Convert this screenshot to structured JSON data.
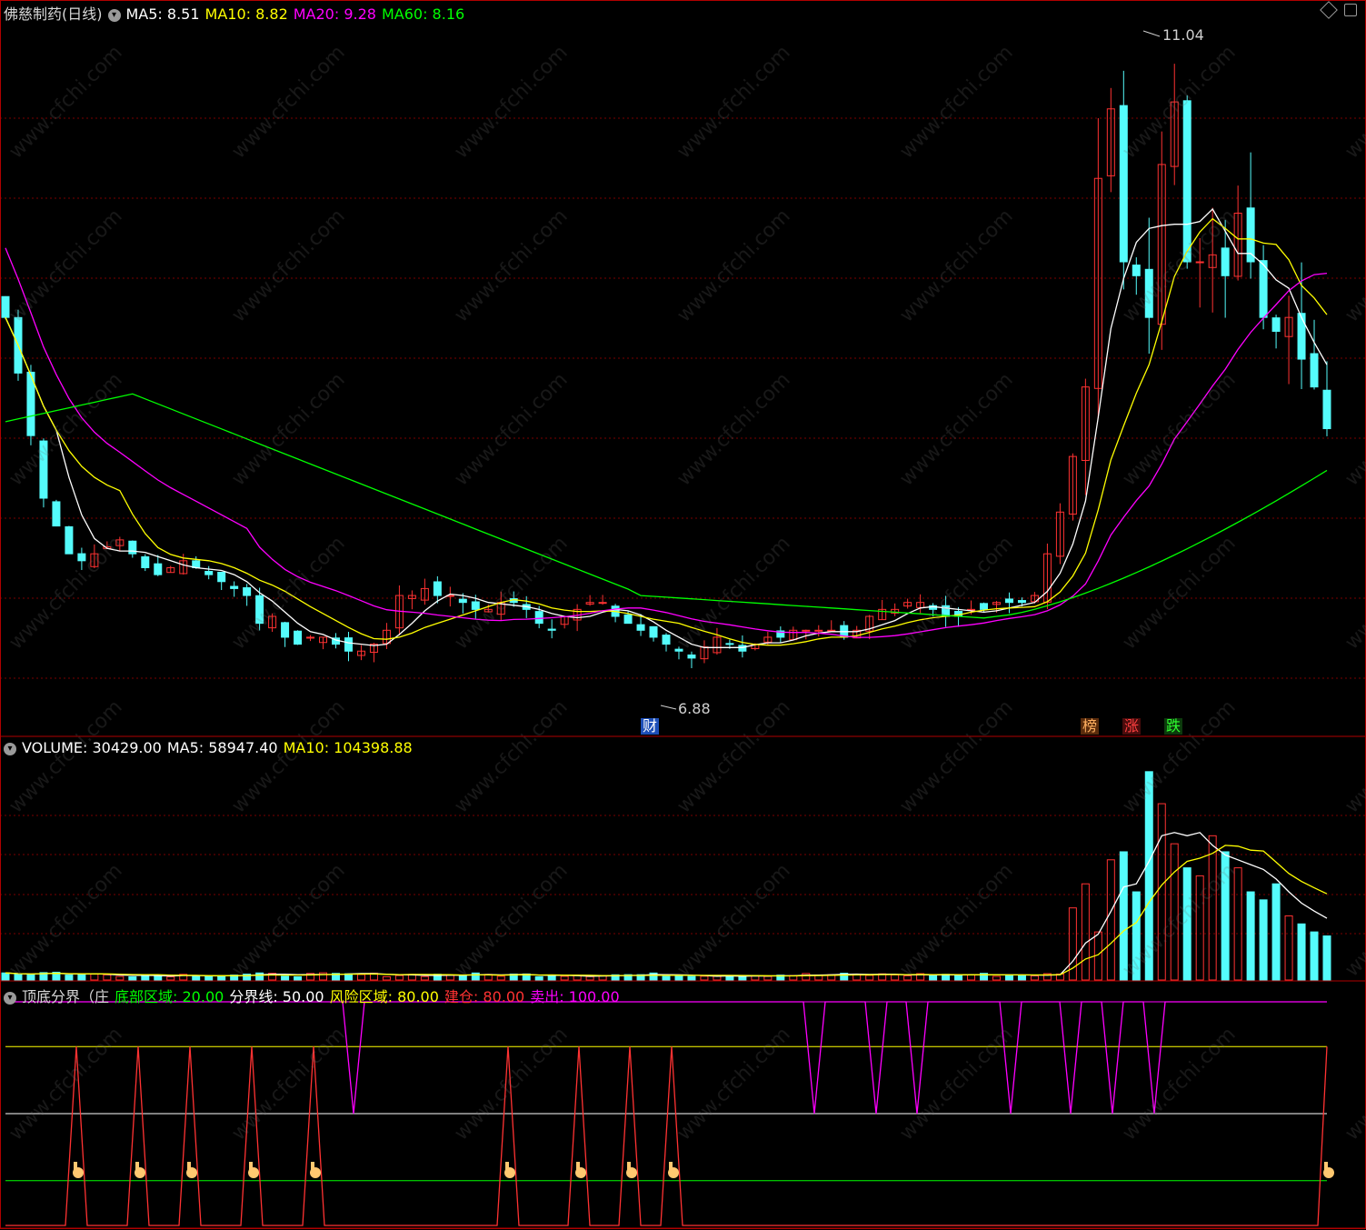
{
  "header_main": {
    "title": "佛慈制药(日线)",
    "ma5_label": "MA5: 8.51",
    "ma10_label": "MA10: 8.82",
    "ma20_label": "MA20: 9.28",
    "ma60_label": "MA60: 8.16"
  },
  "header_volume": {
    "volume_label": "VOLUME: 30429.00",
    "ma5_label": "MA5: 58947.40",
    "ma10_label": "MA10: 104398.88"
  },
  "header_indicator": {
    "name": "顶底分界（庄",
    "bottom_zone": "底部区域: 20.00",
    "divider": "分界线: 50.00",
    "risk_zone": "风险区域: 80.00",
    "build": "建仓: 80.00",
    "sell": "卖出: 100.00"
  },
  "annotations": {
    "high_price": "11.04",
    "low_price": "6.88"
  },
  "tags": {
    "cai": "财",
    "bang": "榜",
    "zhang": "涨",
    "die": "跌"
  },
  "watermark": "www.cfchi.com",
  "colors": {
    "background": "#000000",
    "up": "#ff3232",
    "down": "#54fcfc",
    "ma5": "#ffffff",
    "ma10": "#ffff00",
    "ma20": "#ff00ff",
    "ma60": "#00ff00",
    "grid": "#7a0000",
    "border": "#b00000"
  },
  "chart_data": {
    "type": "candlestick",
    "price": {
      "ylim": [
        6.3,
        11.4
      ],
      "close": [
        9.3,
        8.9,
        8.45,
        8.0,
        7.8,
        7.6,
        7.55,
        7.6,
        7.65,
        7.7,
        7.6,
        7.5,
        7.45,
        7.5,
        7.55,
        7.5,
        7.45,
        7.4,
        7.35,
        7.3,
        7.1,
        7.15,
        7.0,
        6.95,
        7.0,
        7.0,
        6.95,
        6.9,
        6.9,
        6.95,
        7.05,
        7.3,
        7.3,
        7.35,
        7.3,
        7.3,
        7.25,
        7.2,
        7.2,
        7.25,
        7.25,
        7.2,
        7.1,
        7.05,
        7.15,
        7.2,
        7.25,
        7.25,
        7.15,
        7.1,
        7.05,
        7.0,
        6.95,
        6.9,
        6.85,
        6.93,
        7.0,
        6.95,
        6.9,
        6.95,
        7.0,
        7.0,
        7.05,
        7.05,
        7.05,
        7.05,
        7.0,
        7.05,
        7.15,
        7.2,
        7.2,
        7.25,
        7.25,
        7.2,
        7.15,
        7.15,
        7.2,
        7.2,
        7.25,
        7.25,
        7.25,
        7.3,
        7.6,
        7.9,
        8.3,
        8.8,
        10.3,
        10.8,
        9.7,
        9.6,
        9.3,
        10.4,
        10.85,
        9.7,
        9.7,
        9.75,
        9.6,
        10.05,
        9.7,
        9.3,
        9.2,
        9.3,
        9.0,
        8.8,
        8.5
      ],
      "high_label": 11.04,
      "low_label": 6.88
    },
    "indicator": {
      "levels": {
        "bottom_zone": 20,
        "divider": 50,
        "risk_zone": 80,
        "build": 80,
        "sell": 100
      }
    }
  }
}
